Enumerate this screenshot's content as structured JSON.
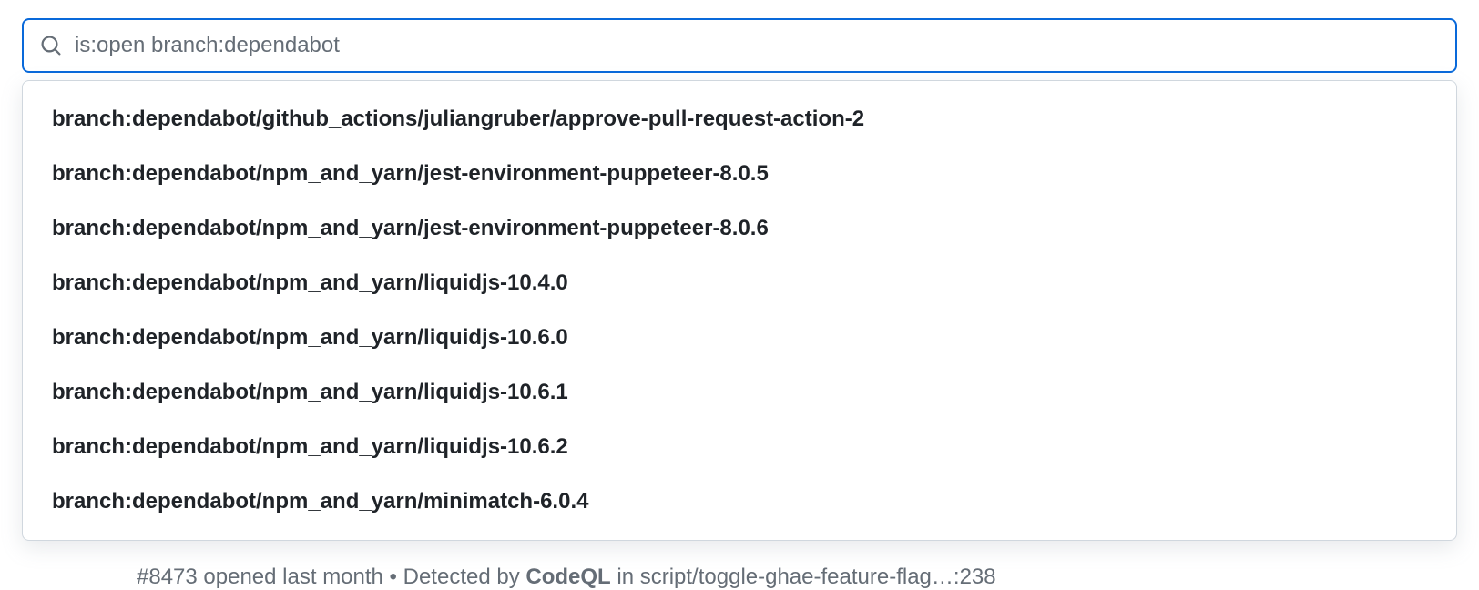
{
  "search": {
    "value": "is:open branch:dependabot"
  },
  "suggestions": [
    "branch:dependabot/github_actions/juliangruber/approve-pull-request-action-2",
    "branch:dependabot/npm_and_yarn/jest-environment-puppeteer-8.0.5",
    "branch:dependabot/npm_and_yarn/jest-environment-puppeteer-8.0.6",
    "branch:dependabot/npm_and_yarn/liquidjs-10.4.0",
    "branch:dependabot/npm_and_yarn/liquidjs-10.6.0",
    "branch:dependabot/npm_and_yarn/liquidjs-10.6.1",
    "branch:dependabot/npm_and_yarn/liquidjs-10.6.2",
    "branch:dependabot/npm_and_yarn/minimatch-6.0.4"
  ],
  "background": {
    "issue_ref": "#8473",
    "opened_text": " opened last month • Detected by ",
    "detector": "CodeQL",
    "path_text": " in script/toggle-ghae-feature-flag…:238"
  }
}
